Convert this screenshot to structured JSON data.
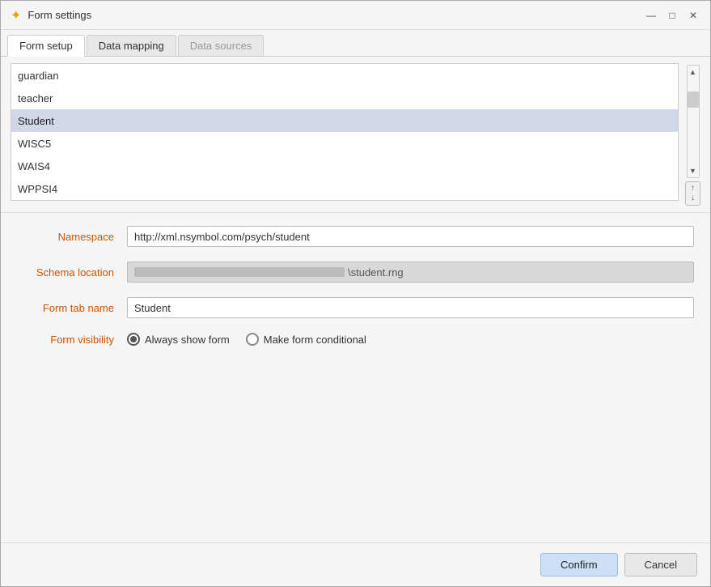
{
  "window": {
    "title": "Form settings",
    "icon": "✦"
  },
  "titlebar": {
    "minimize_label": "—",
    "maximize_label": "□",
    "close_label": "✕"
  },
  "tabs": [
    {
      "id": "form-setup",
      "label": "Form setup",
      "active": true,
      "disabled": false
    },
    {
      "id": "data-mapping",
      "label": "Data mapping",
      "active": false,
      "disabled": false
    },
    {
      "id": "data-sources",
      "label": "Data sources",
      "active": false,
      "disabled": true
    }
  ],
  "list": {
    "items": [
      {
        "label": "guardian",
        "selected": false
      },
      {
        "label": "teacher",
        "selected": false
      },
      {
        "label": "Student",
        "selected": true
      },
      {
        "label": "WISC5",
        "selected": false
      },
      {
        "label": "WAIS4",
        "selected": false
      },
      {
        "label": "WPPSI4",
        "selected": false
      }
    ]
  },
  "fields": {
    "namespace": {
      "label": "Namespace",
      "value": "http://xml.nsymbol.com/psych/student"
    },
    "schema_location": {
      "label": "Schema location",
      "value": "\\student.rng",
      "truncated_prefix": "..."
    },
    "form_tab_name": {
      "label": "Form tab name",
      "value": "Student"
    },
    "form_visibility": {
      "label": "Form visibility",
      "options": [
        {
          "id": "always-show",
          "label": "Always show form",
          "checked": true
        },
        {
          "id": "make-conditional",
          "label": "Make form conditional",
          "checked": false
        }
      ]
    }
  },
  "buttons": {
    "confirm_label": "Confirm",
    "cancel_label": "Cancel"
  }
}
